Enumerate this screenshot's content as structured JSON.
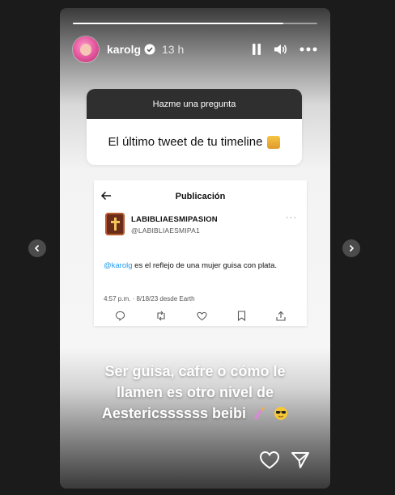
{
  "story": {
    "progress_fraction": 0.86,
    "username": "karolg",
    "time_ago": "13 h"
  },
  "question_box": {
    "header": "Hazme una pregunta",
    "question": "El último tweet de tu timeline",
    "emoji": "person-emoji"
  },
  "tweet": {
    "page_title": "Publicación",
    "display_name": "LABIBLIAESMIPASION",
    "handle": "@LABIBLIAESMIPA1",
    "mention": "@karolg",
    "text_rest": " es el reflejo de una mujer guisa con plata.",
    "meta": "4:57 p.m. · 8/18/23 desde Earth"
  },
  "caption": {
    "line1": "Ser guisa, cafre o cómo le",
    "line2": "llamen es otro nivel de",
    "line3": "Aestericssssss beibi"
  },
  "colors": {
    "mention": "#1d9bf0",
    "question_header_bg": "#2f2f2f",
    "page_bg": "#1b1b1b"
  }
}
